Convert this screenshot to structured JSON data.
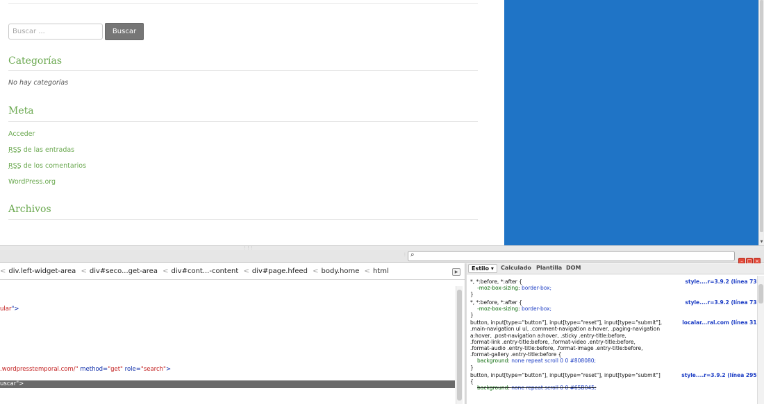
{
  "webpage": {
    "search": {
      "placeholder": "Buscar ...",
      "button_label": "Buscar"
    },
    "categories": {
      "title": "Categorías",
      "empty_text": "No hay categorías"
    },
    "meta": {
      "title": "Meta",
      "links": {
        "login": "Acceder",
        "rss_prefix": "RSS",
        "rss_entries_suffix": " de las entradas",
        "rss_comments_suffix": " de los comentarios",
        "wordpress": "WordPress.org"
      }
    },
    "archives": {
      "title": "Archivos"
    },
    "colors": {
      "panel_blue": "#1f74c6",
      "widget_green": "#6aa84f"
    }
  },
  "devtools": {
    "toolbar": {
      "search_icon": "search-icon",
      "window_buttons": [
        "minimize",
        "restore",
        "close"
      ]
    },
    "breadcrumbs": [
      "div.left-widget-area",
      "div#seco...get-area",
      "div#cont...-content",
      "div#page.hfeed",
      "body.home",
      "html"
    ],
    "html_panel": {
      "line1_val": "ular",
      "line1_end": "\">",
      "line2_val": ".wordpresstemporal.com/",
      "line2_q": "\"",
      "line2_attr_method": " method=",
      "line2_method_val": "\"get\"",
      "line2_attr_role": " role=",
      "line2_role_val": "\"search\"",
      "line2_end": ">",
      "selected_line": "uscar\">"
    },
    "style_tabs": {
      "active": "Estilo ▾",
      "computed": "Calculado",
      "template": "Plantilla",
      "dom": "DOM"
    },
    "rules": [
      {
        "selector": "*, *:before, *:after {",
        "prop": "-moz-box-sizing",
        "value": "border-box;",
        "source": "style....r=3.9.2 (línea 73)"
      },
      {
        "selector": "*, *:before, *:after {",
        "prop": "-moz-box-sizing",
        "value": "border-box;",
        "source": "style....r=3.9.2 (línea 73)"
      },
      {
        "selector": "button, input[type=\"button\"], input[type=\"reset\"], input[type=\"submit\"],\n.main-navigation ul ul, .comment-navigation a:hover, .paging-navigation\na:hover, .post-navigation a:hover, .sticky .entry-title:before,\n.format-link .entry-title:before, .format-video .entry-title:before,\n.format-audio .entry-title:before, .format-image .entry-title:before,\n.format-gallery .entry-title:before {",
        "prop": "background",
        "value": "none repeat scroll 0 0 #808080;",
        "source": "localar...ral.com (línea 31)"
      },
      {
        "selector": "button, input[type=\"button\"], input[type=\"reset\"], input[type=\"submit\"]\n{",
        "prop": "background",
        "value": "none repeat scroll 0 0 #65B045;",
        "source": "style....r=3.9.2 (línea 295)"
      }
    ],
    "close_brace": "}"
  }
}
